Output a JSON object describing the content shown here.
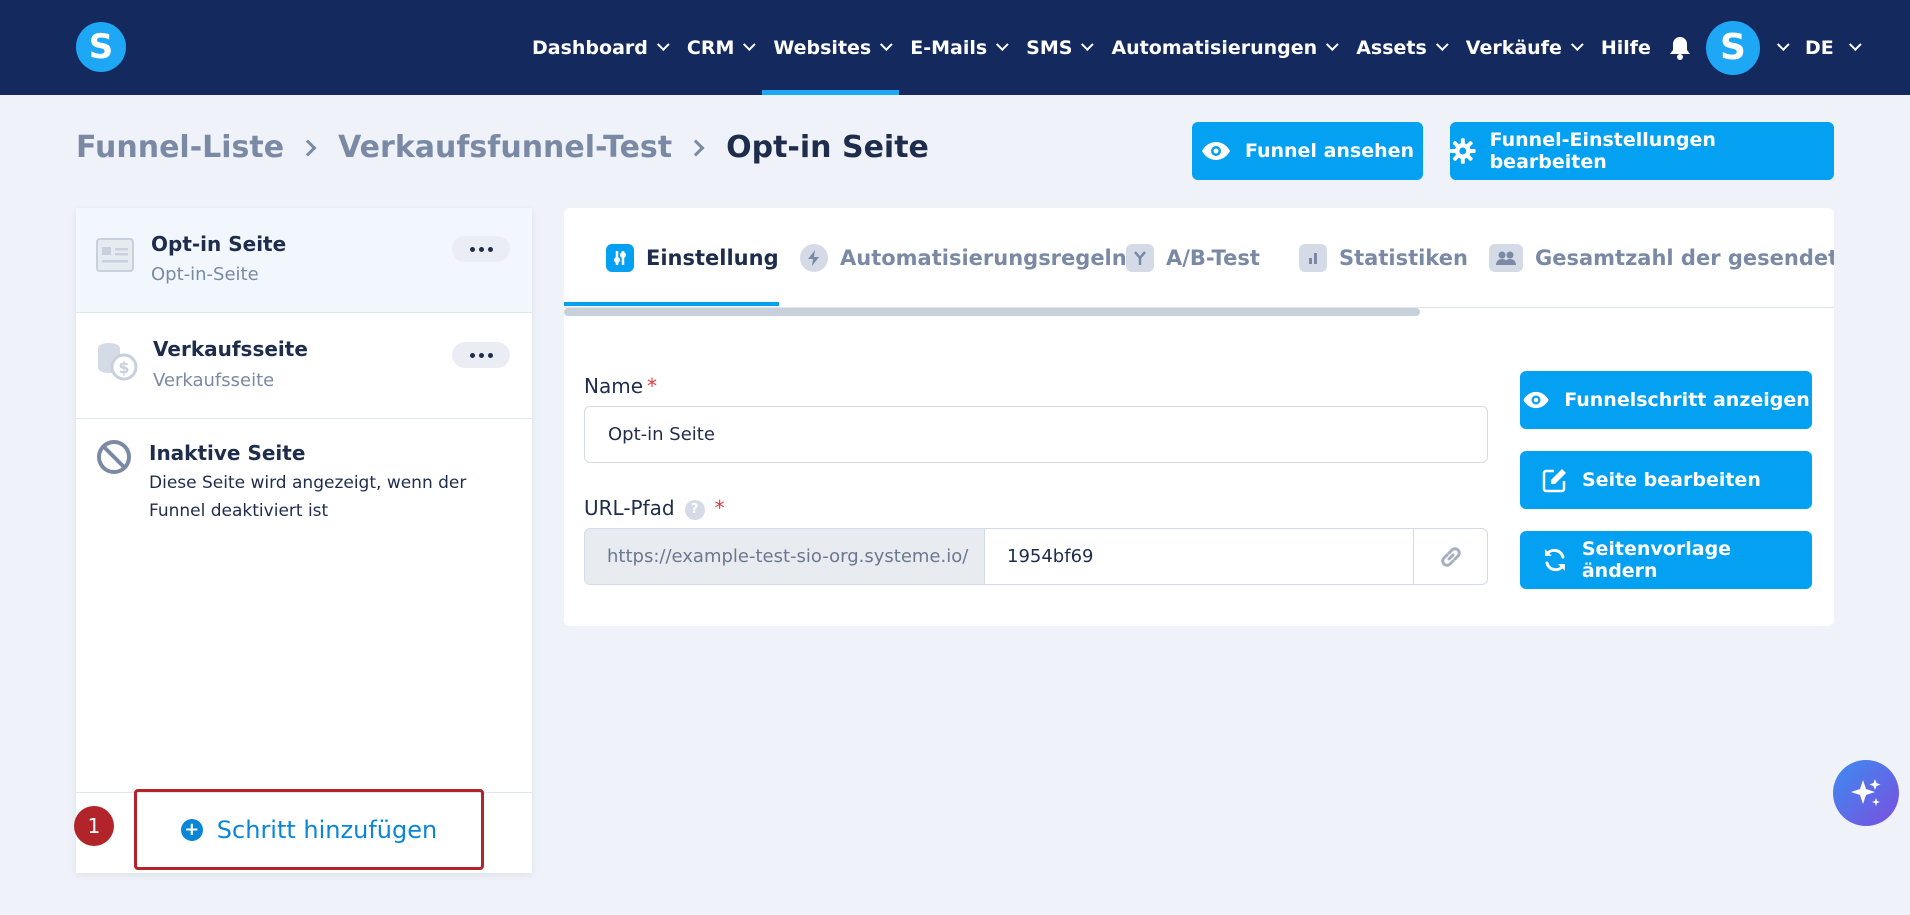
{
  "app": {
    "logo_letter": "S"
  },
  "nav": {
    "items": [
      {
        "label": "Dashboard",
        "has_dropdown": true
      },
      {
        "label": "CRM",
        "has_dropdown": true
      },
      {
        "label": "Websites",
        "has_dropdown": true,
        "active": true
      },
      {
        "label": "E-Mails",
        "has_dropdown": true
      },
      {
        "label": "SMS",
        "has_dropdown": true
      },
      {
        "label": "Automatisierungen",
        "has_dropdown": true
      },
      {
        "label": "Assets",
        "has_dropdown": true
      },
      {
        "label": "Verkäufe",
        "has_dropdown": true
      },
      {
        "label": "Hilfe",
        "has_dropdown": false
      }
    ],
    "avatar_letter": "S",
    "language": "DE"
  },
  "breadcrumb": {
    "items": [
      "Funnel-Liste",
      "Verkaufsfunnel-Test"
    ],
    "current": "Opt-in Seite"
  },
  "header_actions": {
    "view_funnel": "Funnel ansehen",
    "edit_settings": "Funnel-Einstellungen bearbeiten"
  },
  "steps": [
    {
      "title": "Opt-in Seite",
      "subtitle": "Opt-in-Seite",
      "icon": "optin-page-icon",
      "active": true
    },
    {
      "title": "Verkaufsseite",
      "subtitle": "Verkaufsseite",
      "icon": "sales-page-icon",
      "active": false
    }
  ],
  "inactive_page": {
    "title": "Inaktive Seite",
    "description": "Diese Seite wird angezeigt, wenn der Funnel deaktiviert ist"
  },
  "add_step": {
    "label": "Schritt hinzufügen",
    "marker": "1"
  },
  "tabs": [
    {
      "label": "Einstellung",
      "active": true
    },
    {
      "label": "Automatisierungsregeln",
      "active": false
    },
    {
      "label": "A/B-Test",
      "active": false
    },
    {
      "label": "Statistiken",
      "active": false
    },
    {
      "label": "Gesamtzahl der gesendeten L",
      "active": false
    }
  ],
  "form": {
    "name_label": "Name",
    "name_value": "Opt-in Seite",
    "required_mark": "*",
    "url_label": "URL-Pfad",
    "help_mark": "?",
    "url_prefix": "https://example-test-sio-org.systeme.io/",
    "url_slug": "1954bf69"
  },
  "side_actions": {
    "show_step": "Funnelschritt anzeigen",
    "edit_page": "Seite bearbeiten",
    "change_template": "Seitenvorlage ändern"
  },
  "colors": {
    "navbar": "#142a5f",
    "primary": "#04a0f2",
    "highlight_border": "#b3242a",
    "background": "#eff2f8"
  }
}
